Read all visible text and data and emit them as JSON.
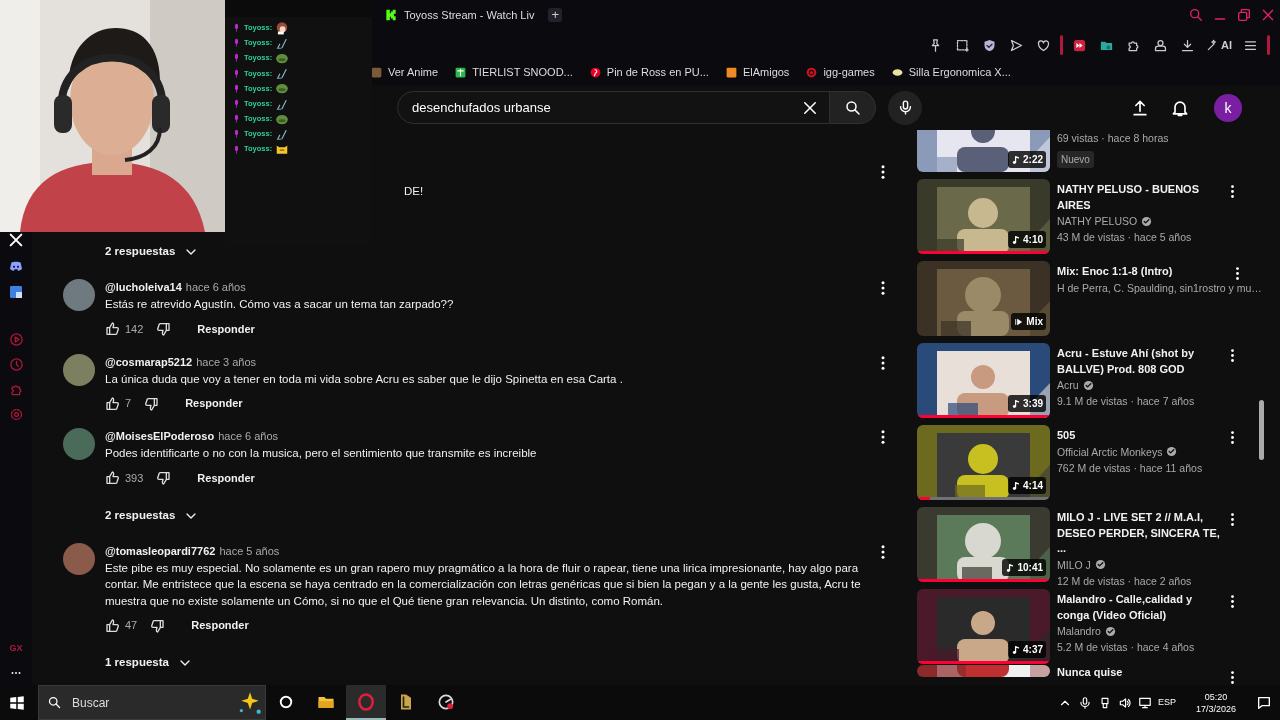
{
  "browser": {
    "tab": {
      "title": "Toyoss Stream - Watch Liv",
      "selected": true
    },
    "new_tab": "+",
    "ai_button": "AI",
    "bookmarks": [
      {
        "label": "Ver Anime"
      },
      {
        "label": "TIERLIST SNOOD..."
      },
      {
        "label": "Pin de Ross en PU..."
      },
      {
        "label": "ElAmigos"
      },
      {
        "label": "igg-games"
      },
      {
        "label": "Silla Ergonomica X..."
      }
    ]
  },
  "stream_overlay": {
    "chat": [
      {
        "user": "Toyoss:",
        "kind": "girl"
      },
      {
        "user": "Toyoss:",
        "kind": "brush"
      },
      {
        "user": "Toyoss:",
        "kind": "frog"
      },
      {
        "user": "Toyoss:",
        "kind": "brush"
      },
      {
        "user": "Toyoss:",
        "kind": "frog"
      },
      {
        "user": "Toyoss:",
        "kind": "brush"
      },
      {
        "user": "Toyoss:",
        "kind": "frog"
      },
      {
        "user": "Toyoss:",
        "kind": "brush"
      },
      {
        "user": "Toyoss:",
        "kind": "cat"
      }
    ]
  },
  "sidebar": {
    "logo_text": "GX"
  },
  "youtube": {
    "search": {
      "value": "desenchufados urbanse"
    },
    "avatar": "k",
    "comments": [
      {
        "kind": "partial",
        "text": "DE!",
        "replies": "2 respuestas"
      },
      {
        "kind": "comment",
        "user": "@lucholeiva14",
        "time": "hace 6 años",
        "text": "Estás re atrevido Agustín. Cómo vas a sacar un tema tan zarpado??",
        "likes": "142",
        "reply": "Responder"
      },
      {
        "kind": "comment",
        "user": "@cosmarap5212",
        "time": "hace 3 años",
        "text": "La única duda que voy a tener en toda mi vida sobre Acru es saber que le dijo Spinetta en esa Carta .",
        "likes": "7",
        "reply": "Responder"
      },
      {
        "kind": "comment",
        "user": "@MoisesElPoderoso",
        "time": "hace 6 años",
        "text": "Podes identificarte o no con la musica, pero el sentimiento que transmite es increible",
        "likes": "393",
        "reply": "Responder",
        "replies": "2 respuestas"
      },
      {
        "kind": "comment",
        "user": "@tomasleopardi7762",
        "time": "hace 5 años",
        "text": "Este pibe es muy especial. No solamente es un gran rapero muy pragmático a la hora de fluir o rapear, tiene una lirica impresionante, hay algo para contar. Me entristece que la escena se haya centrado en la comercialización con letras genéricas que si bien la pegan y a la gente les gusta, Acru te muestra que no existe solamente un Cómo, si no que el Qué tiene gran relevancia. Un distinto, como Román.",
        "likes": "47",
        "reply": "Responder",
        "replies": "1 respuesta"
      }
    ],
    "recommended": [
      {
        "kind": "partial",
        "views": "69 vistas · hace 8 horas",
        "badge": "Nuevo",
        "duration": "2:22"
      },
      {
        "kind": "video",
        "title": "NATHY PELUSO - BUENOS AIRES",
        "channel": "NATHY PELUSO",
        "verified": true,
        "views": "43 M de vistas · hace 5 años",
        "duration": "4:10",
        "level": 1
      },
      {
        "kind": "mix",
        "title": "Mix: Enoc 1:1-8 (Intro)",
        "channel": "H de Perra, C. Spaulding, sin1rostro y mu…",
        "duration": "Mix"
      },
      {
        "kind": "video",
        "title": "Acru - Estuve Ahí (shot by BALLVE) Prod. 808 GOD",
        "channel": "Acru",
        "verified": true,
        "views": "9.1 M de vistas · hace 7 años",
        "duration": "3:39",
        "level": 1
      },
      {
        "kind": "video",
        "title": "505",
        "channel": "Official Arctic Monkeys",
        "verified": true,
        "views": "762 M de vistas · hace 11 años",
        "duration": "4:14",
        "level": 0.1
      },
      {
        "kind": "video",
        "title": "MILO J - LIVE SET 2 // M.A.I, DESEO PERDER, SINCERA TE, ...",
        "channel": "MILO J",
        "verified": true,
        "views": "12 M de vistas · hace 2 años",
        "duration": "10:41",
        "level": 1
      },
      {
        "kind": "video",
        "title": "Malandro - Calle,calidad y conga (Video Oficial)",
        "channel": "Malandro",
        "verified": true,
        "views": "5.2 M de vistas · hace 4 años",
        "duration": "4:37",
        "level": 1
      },
      {
        "kind": "cut",
        "title": "Nunca quise"
      }
    ]
  },
  "taskbar": {
    "search": {
      "placeholder": "Buscar"
    },
    "apps": [
      {
        "kind": "folder",
        "selected": false
      },
      {
        "kind": "opera",
        "selected": true
      },
      {
        "kind": "game",
        "selected": false
      },
      {
        "kind": "tool",
        "selected": false
      }
    ],
    "language": "ESP",
    "time": "05:20",
    "date": "17/3/2026"
  }
}
